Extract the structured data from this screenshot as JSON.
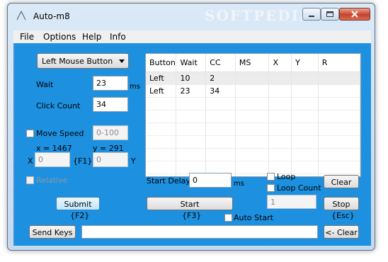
{
  "window": {
    "title": "Auto-m8",
    "watermark": "SOFTPEDIA"
  },
  "menu": [
    "File",
    "Options",
    "Help",
    "Info"
  ],
  "left": {
    "mouse_button": "Left Mouse Button",
    "wait_label": "Wait",
    "wait_value": "23",
    "wait_unit": "ms",
    "click_count_label": "Click Count",
    "click_count_value": "34",
    "move_speed_label": "Move Speed",
    "move_speed_placeholder": "0-100",
    "coords_x": "x  =  1467",
    "coords_y": "y  =  291",
    "x_label": "X",
    "x_value": "0",
    "f1_label": "{F1}",
    "y_value": "0",
    "y_label": "Y",
    "relative_label": "Relative",
    "submit_label": "Submit",
    "submit_hotkey": "{F2}"
  },
  "grid": {
    "headers": [
      "Button",
      "Wait",
      "CC",
      "MS",
      "X",
      "Y",
      "R"
    ],
    "rows": [
      [
        "Left",
        "10",
        "2",
        "",
        "",
        "",
        ""
      ],
      [
        "Left",
        "23",
        "34",
        "",
        "",
        "",
        ""
      ]
    ]
  },
  "controls": {
    "start_delay_label": "Start Delay",
    "start_delay_value": "0",
    "start_delay_unit": "ms",
    "loop_label": "Loop",
    "loop_count_label": "Loop Count",
    "loop_count_value": "1",
    "clear_label": "Clear",
    "start_label": "Start",
    "start_hotkey": "{F3}",
    "stop_label": "Stop",
    "stop_hotkey": "{Esc}",
    "auto_start_label": "Auto Start",
    "send_keys_label": "Send Keys",
    "send_keys_value": "",
    "back_clear_label": "<- Clear"
  }
}
